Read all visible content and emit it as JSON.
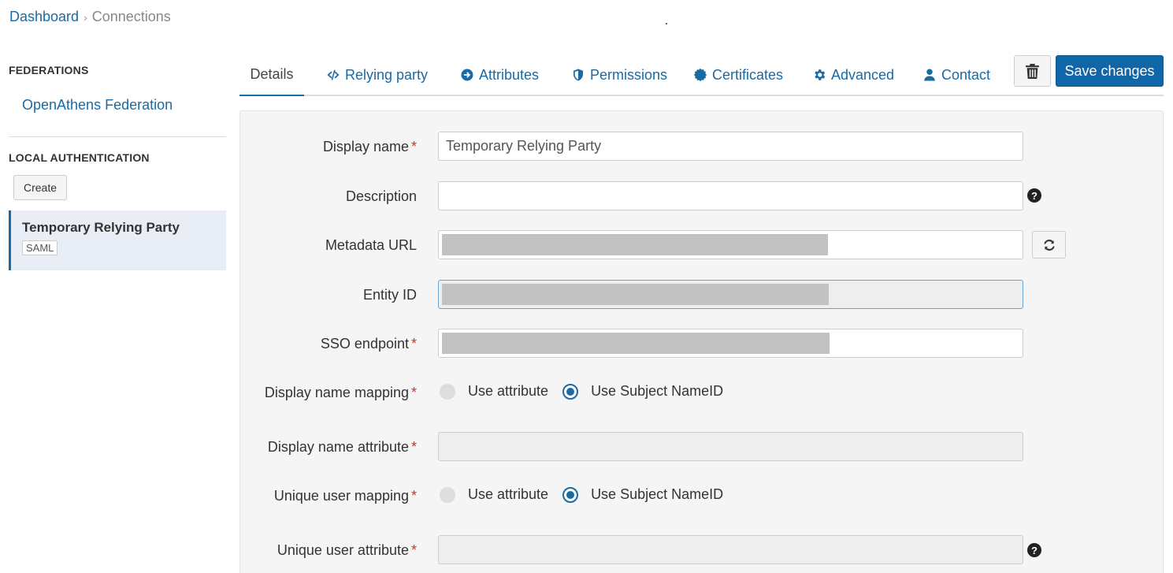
{
  "breadcrumb": {
    "home": "Dashboard",
    "separator": "›",
    "current": "Connections"
  },
  "sidebar": {
    "federations_heading": "FEDERATIONS",
    "federation_link": "OpenAthens Federation",
    "local_heading": "LOCAL AUTHENTICATION",
    "create_label": "Create",
    "selected_item": {
      "title": "Temporary Relying Party",
      "badge": "SAML"
    }
  },
  "tabs": [
    {
      "label": "Details",
      "icon": "none"
    },
    {
      "label": "Relying party",
      "icon": "code-icon"
    },
    {
      "label": "Attributes",
      "icon": "arrow-circle-right-icon"
    },
    {
      "label": "Permissions",
      "icon": "shield-icon"
    },
    {
      "label": "Certificates",
      "icon": "certificate-icon"
    },
    {
      "label": "Advanced",
      "icon": "gear-icon"
    },
    {
      "label": "Contact",
      "icon": "user-icon"
    }
  ],
  "toolbar": {
    "delete_icon": "trash-icon",
    "save_label": "Save changes"
  },
  "form": {
    "display_name": {
      "label": "Display name",
      "required": "*",
      "value": "Temporary Relying Party"
    },
    "description": {
      "label": "Description",
      "value": "",
      "help": "?"
    },
    "metadata_url": {
      "label": "Metadata URL",
      "value": ""
    },
    "entity_id": {
      "label": "Entity ID",
      "value": ""
    },
    "sso_endpoint": {
      "label": "SSO endpoint",
      "required": "*",
      "value": ""
    },
    "display_name_mapping": {
      "label": "Display name mapping",
      "required": "*",
      "option_1": "Use attribute",
      "option_2": "Use Subject NameID",
      "selected": "Use Subject NameID"
    },
    "display_name_attribute": {
      "label": "Display name attribute",
      "required": "*",
      "value": ""
    },
    "unique_user_mapping": {
      "label": "Unique user mapping",
      "required": "*",
      "option_1": "Use attribute",
      "option_2": "Use Subject NameID",
      "selected": "Use Subject NameID"
    },
    "unique_user_attribute": {
      "label": "Unique user attribute",
      "required": "*",
      "value": "",
      "help": "?"
    }
  },
  "colors": {
    "accent": "#1166a8",
    "link": "#1a6aa3",
    "required": "#c0392b"
  }
}
